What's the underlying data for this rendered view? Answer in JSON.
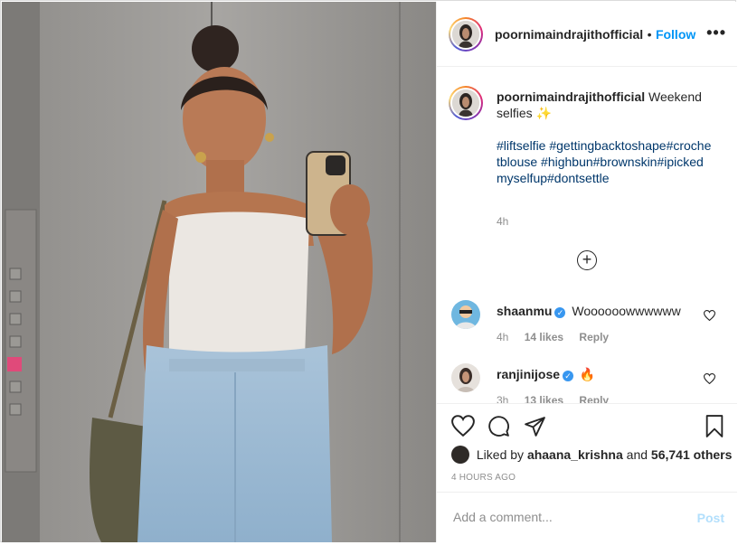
{
  "post": {
    "username": "poornimaindrajithofficial",
    "dot": "•",
    "follow_label": "Follow",
    "more_label": "•••",
    "caption_text": "Weekend selfies",
    "caption_emoji": "✨",
    "hashtags": "#liftselfie #gettingbacktoshape#crochetblouse #highbun#brownskin#ipickedmyselfup#dontsettle",
    "caption_time": "4h",
    "load_more_label": "+"
  },
  "comments": [
    {
      "username": "shaanmu",
      "verified": true,
      "text": "Woooooowwwwww",
      "time": "4h",
      "likes": "14 likes",
      "reply": "Reply"
    },
    {
      "username": "ranjinijose",
      "verified": true,
      "text": "🔥",
      "time": "3h",
      "likes": "13 likes",
      "reply": "Reply"
    }
  ],
  "actions": {
    "liked_by_prefix": "Liked by",
    "liked_by_user": "ahaana_krishna",
    "and": "and",
    "others": "56,741 others",
    "ago": "4 HOURS AGO"
  },
  "comment_box": {
    "placeholder": "Add a comment...",
    "post_label": "Post"
  },
  "icons": {
    "like": "heart-icon",
    "comment": "comment-icon",
    "share": "share-icon",
    "save": "bookmark-icon",
    "more": "more-options-icon",
    "comment_like": "heart-icon"
  },
  "colors": {
    "link_blue": "#0095f6",
    "hashtag": "#00376b",
    "verified": "#3897f0",
    "muted": "#8e8e8e",
    "post_disabled": "#b2dffc"
  }
}
